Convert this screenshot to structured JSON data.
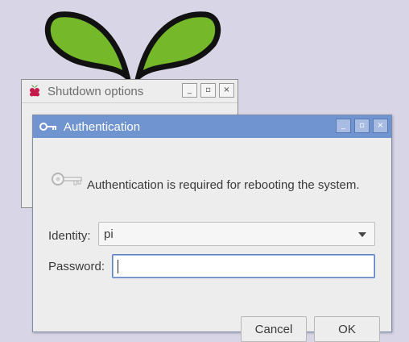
{
  "background": {
    "color": "#d8d6e6",
    "logo": "raspberry-leaves"
  },
  "shutdown_window": {
    "title": "Shutdown options",
    "icon": "raspberry-icon",
    "controls": {
      "minimize": "_",
      "maximize": "▫",
      "close": "×"
    }
  },
  "auth_window": {
    "title": "Authentication",
    "icon": "key-icon",
    "accent": "#7094cf",
    "controls": {
      "minimize": "_",
      "maximize": "▫",
      "close": "×"
    },
    "message": "Authentication is required for rebooting the system.",
    "identity": {
      "label": "Identity:",
      "value": "pi"
    },
    "password": {
      "label": "Password:",
      "value": ""
    },
    "buttons": {
      "cancel": "Cancel",
      "ok": "OK"
    }
  }
}
